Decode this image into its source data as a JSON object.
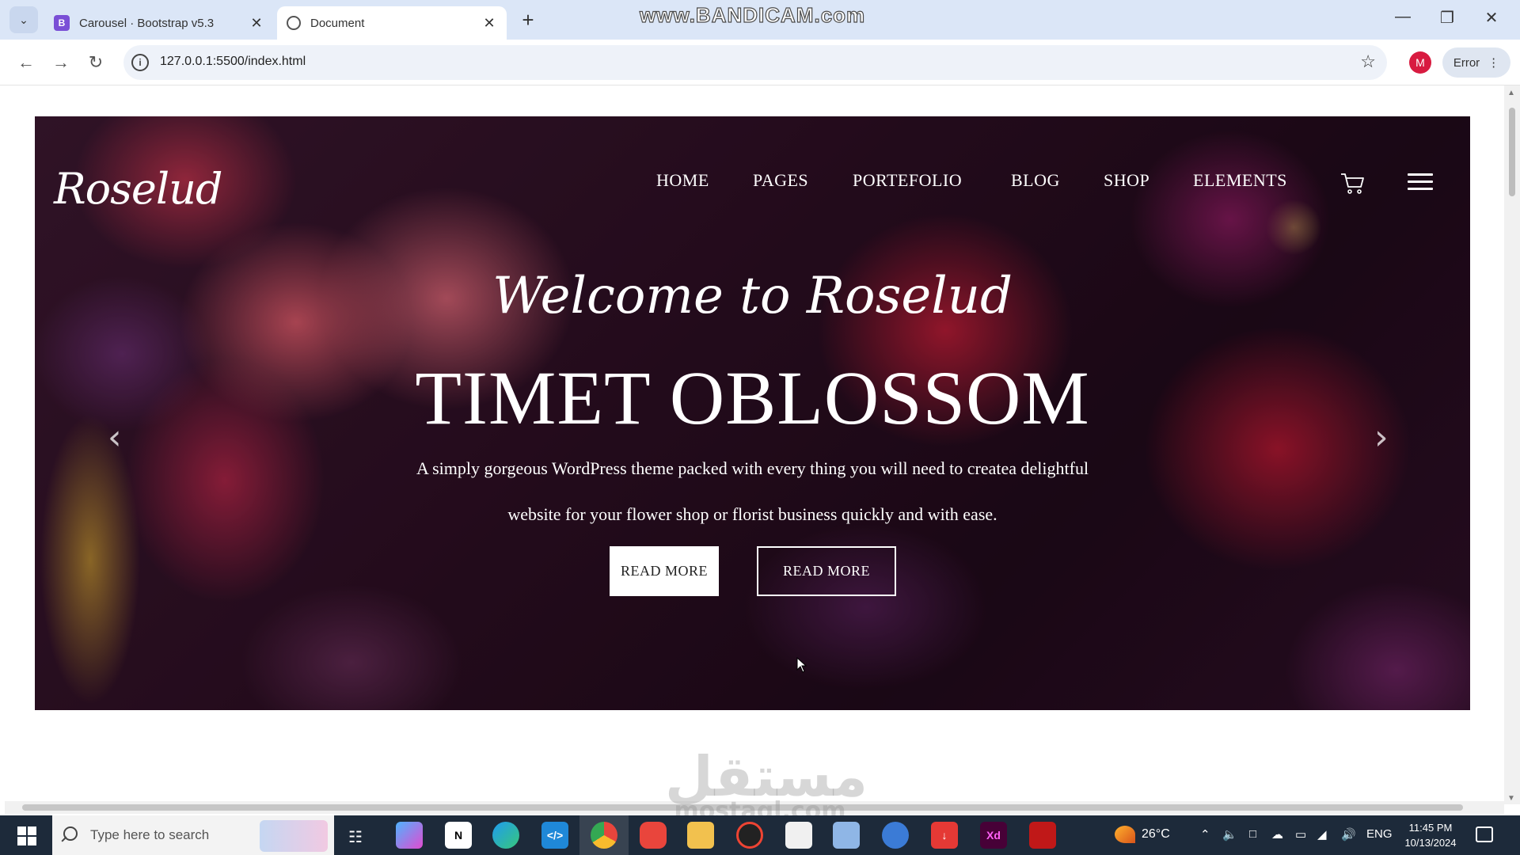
{
  "browser": {
    "tabs": [
      {
        "favicon": "bootstrap-icon",
        "title": "Carousel · Bootstrap v5.3"
      },
      {
        "favicon": "globe-icon",
        "title": "Document"
      }
    ],
    "recording_watermark": "www.BANDICAM.com",
    "url": "127.0.0.1:5500/index.html",
    "profile_initial": "M",
    "error_chip": "Error"
  },
  "site": {
    "brand": "Roselud",
    "nav": [
      "HOME",
      "PAGES",
      "PORTEFOLIO",
      "BLOG",
      "SHOP",
      "ELEMENTS"
    ],
    "hero": {
      "welcome": "Welcome to Roselud",
      "headline": "TIMET OBLOSSOM",
      "subtitle_line1": "A simply gorgeous WordPress theme packed with every thing you will need to createa delightful",
      "subtitle_line2": "website for your flower shop or florist business quickly and with ease.",
      "button_primary": "READ MORE",
      "button_secondary": "READ MORE"
    }
  },
  "watermark": {
    "arabic": "مستقل",
    "latin": "mostaql.com"
  },
  "taskbar": {
    "search_placeholder": "Type here to search",
    "weather": "26°C",
    "language": "ENG",
    "time": "11:45 PM",
    "date": "10/13/2024",
    "apps": [
      "copilot-icon",
      "notion-icon",
      "edge-icon",
      "vscode-icon",
      "chrome-icon",
      "screenshot-app-icon",
      "file-explorer-icon",
      "record-app-icon",
      "microsoft-store-icon",
      "notepad-icon",
      "media-app-icon",
      "download-app-icon",
      "adobe-xd-icon",
      "mcafee-icon"
    ]
  },
  "colors": {
    "accent": "#7a4fd6",
    "taskbar": "#1d2a3a",
    "hero_overlay_text": "#ffffff"
  }
}
